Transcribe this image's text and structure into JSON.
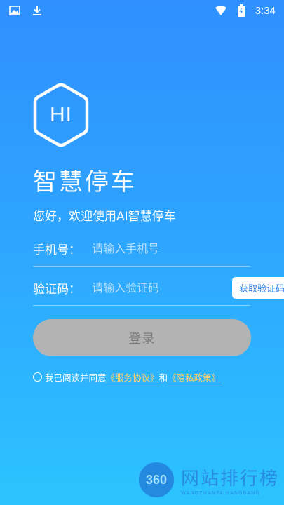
{
  "status_bar": {
    "time": "3:34",
    "left_icons": [
      "image-icon",
      "download-icon"
    ],
    "right_icons": [
      "wifi-icon",
      "battery-charging-icon"
    ]
  },
  "logo": {
    "text": "HI"
  },
  "title": "智慧停车",
  "welcome": "您好，欢迎使用AI智慧停车",
  "form": {
    "phone": {
      "label": "手机号：",
      "placeholder": "请输入手机号",
      "value": ""
    },
    "code": {
      "label": "验证码：",
      "placeholder": "请输入验证码",
      "value": "",
      "button_label": "获取验证码"
    }
  },
  "login_button": "登录",
  "agreement": {
    "prefix": "我已阅读并同意",
    "service_link": "《服务协议》",
    "conjunction": "和",
    "privacy_link": "《隐私政策》"
  },
  "watermark": {
    "logo_text": "360",
    "main": "网站排行榜",
    "sub": "WANGZHANPAIHANGBANG"
  },
  "colors": {
    "background_top": "#2f8fff",
    "background_bottom": "#2cc3ff",
    "link": "#ffd36a",
    "login_disabled": "#b3b3b3"
  }
}
